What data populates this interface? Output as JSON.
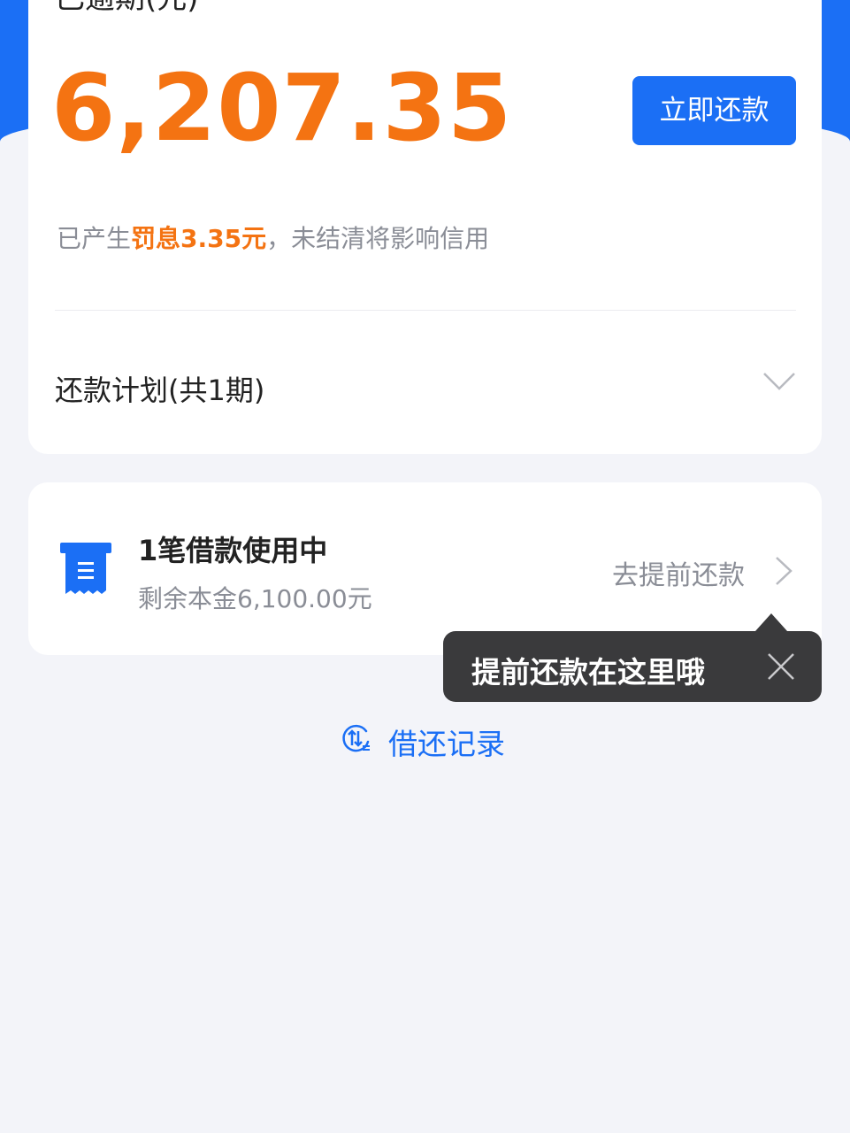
{
  "overdue": {
    "title": "已逾期(元)",
    "amount": "6,207.35",
    "repay_button": "立即还款",
    "penalty_prefix": "已产生",
    "penalty_highlight": "罚息3.35元",
    "penalty_suffix": "，未结清将影响信用"
  },
  "plan": {
    "label": "还款计划(共1期)"
  },
  "loan": {
    "title": "1笔借款使用中",
    "remaining": "剩余本金6,100.00元",
    "prepay_link": "去提前还款"
  },
  "tooltip": {
    "text": "提前还款在这里哦"
  },
  "records": {
    "label": "借还记录"
  },
  "colors": {
    "brand_blue": "#1b6ff5",
    "amount_orange": "#f47312",
    "tooltip_bg": "#3a3a3c"
  },
  "icons": {
    "overdue_chevron": "chevron-right-icon",
    "plan_chevron": "chevron-down-icon",
    "loan_icon": "receipt-icon",
    "prepay_chevron": "chevron-right-icon",
    "tooltip_close": "close-icon",
    "records_icon": "exchange-record-icon"
  }
}
